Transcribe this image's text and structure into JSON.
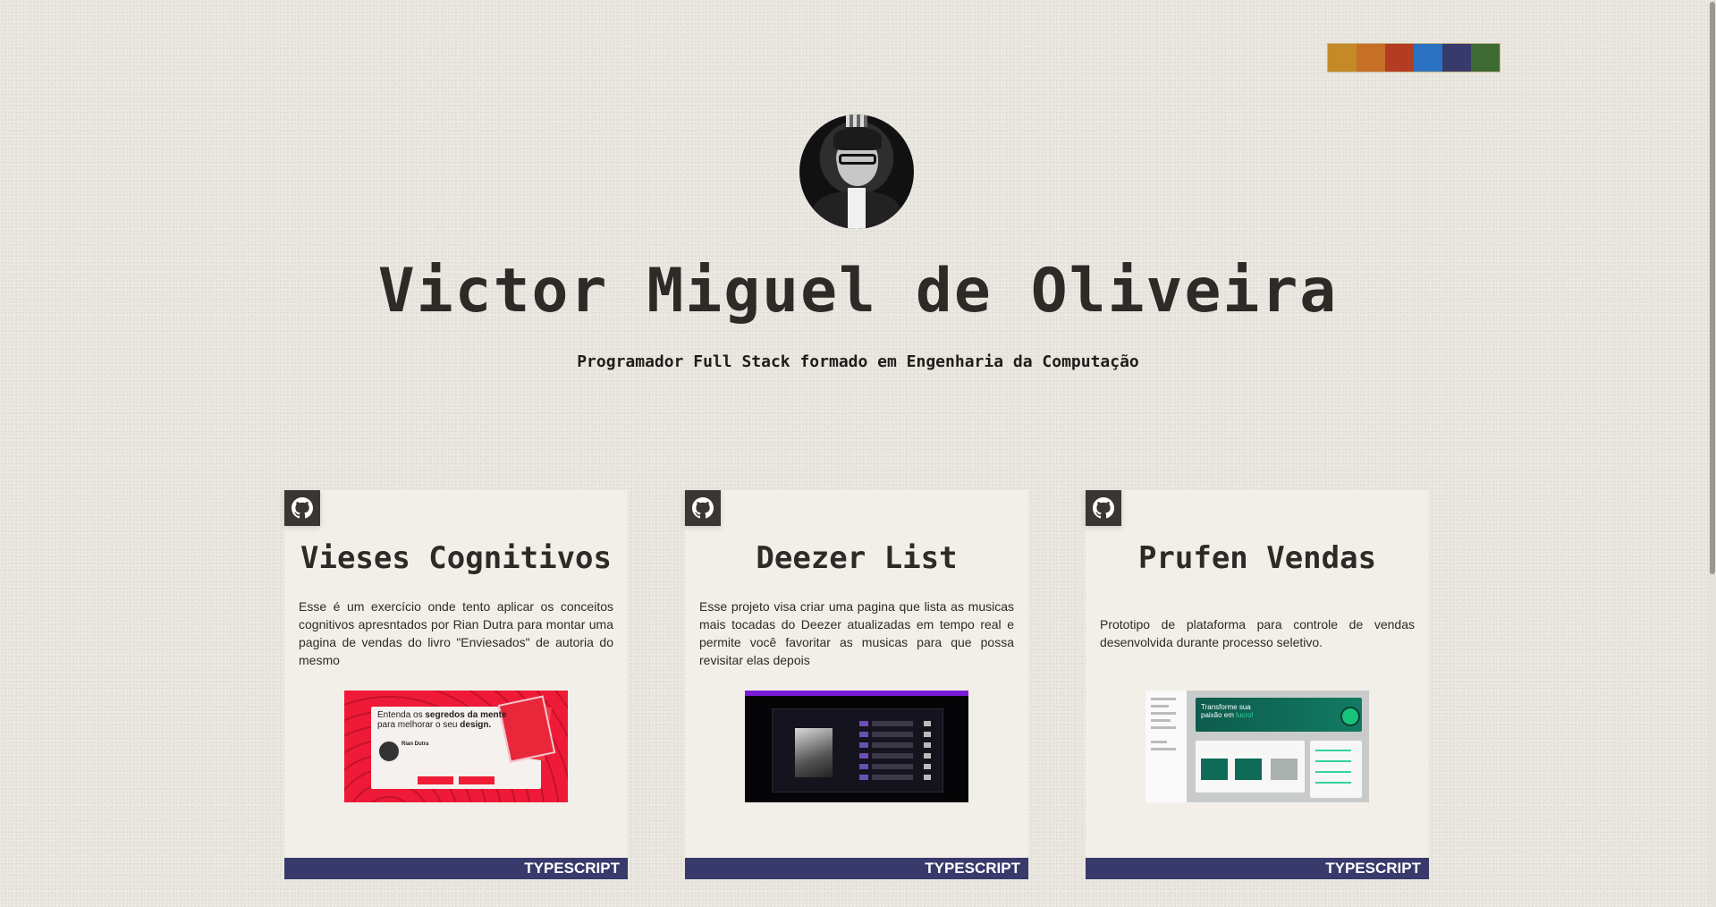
{
  "palette": {
    "swatches": [
      "#c58a28",
      "#c66f27",
      "#b43c22",
      "#2b71c1",
      "#383a6b",
      "#3e6b34"
    ]
  },
  "profile": {
    "name": "Victor Miguel de Oliveira",
    "subtitle": "Programador Full Stack formado em Engenharia da Computação"
  },
  "projects": [
    {
      "title": "Vieses Cognitivos",
      "description": "Esse é um exercício onde tento aplicar os conceitos cognitivos apresntados por Rian Dutra para montar uma pagina de vendas do livro \"Enviesados\" de autoria do mesmo",
      "language": "TYPESCRIPT",
      "thumb": {
        "headline_a": "Entenda os ",
        "headline_b": "segredos da mente",
        "headline_c": "para melhorar o seu ",
        "headline_d": "design.",
        "author": "Rian Dutra"
      }
    },
    {
      "title": "Deezer List",
      "description": "Esse projeto visa criar uma pagina que lista as musicas mais tocadas do Deezer atualizadas em tempo real e permite você favoritar as musicas para que possa revisitar elas depois",
      "language": "TYPESCRIPT"
    },
    {
      "title": "Prufen Vendas",
      "description": "Prototipo de plataforma para controle de vendas desenvolvida durante processo seletivo.",
      "language": "TYPESCRIPT",
      "thumb": {
        "hero_a": "Transforme sua",
        "hero_b": "paixão em ",
        "hero_c": "lucro!"
      }
    }
  ],
  "icons": {
    "github": "github-icon"
  }
}
